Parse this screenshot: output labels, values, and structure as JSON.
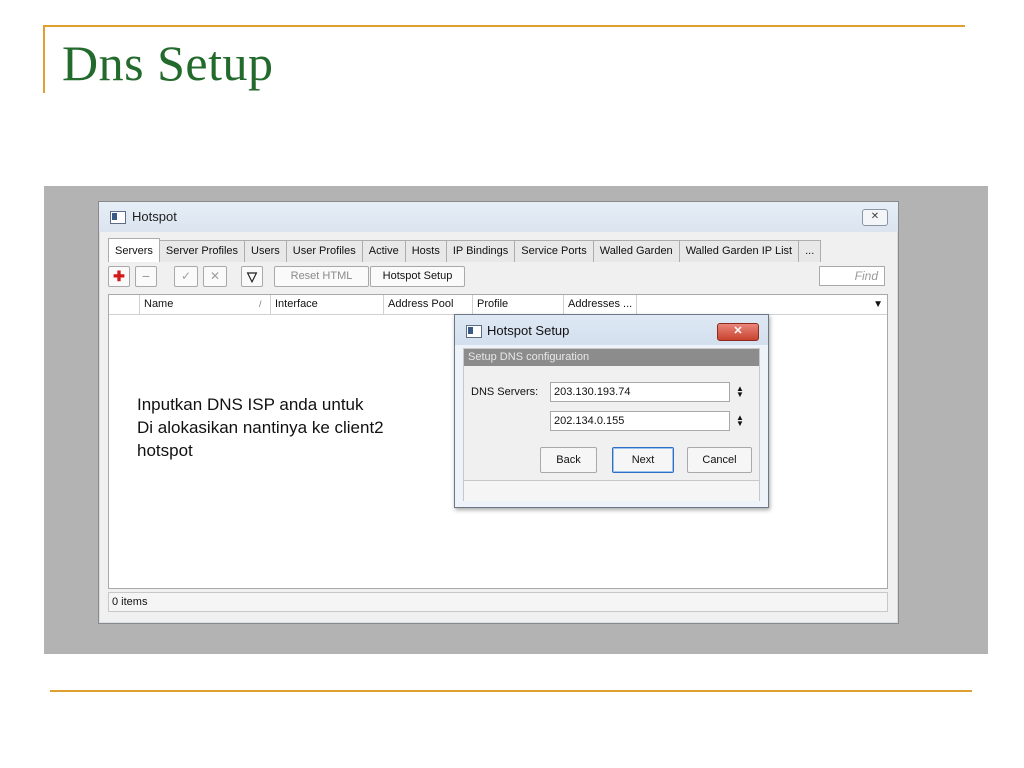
{
  "slide": {
    "title": "Dns Setup",
    "accent_color": "#e0a030",
    "title_color": "#236b2d"
  },
  "window": {
    "title": "Hotspot",
    "close_glyph": "✕",
    "icon": "window-icon",
    "tabs": [
      {
        "label": "Servers"
      },
      {
        "label": "Server Profiles"
      },
      {
        "label": "Users"
      },
      {
        "label": "User Profiles"
      },
      {
        "label": "Active"
      },
      {
        "label": "Hosts"
      },
      {
        "label": "IP Bindings"
      },
      {
        "label": "Service Ports"
      },
      {
        "label": "Walled Garden"
      },
      {
        "label": "Walled Garden IP List"
      },
      {
        "label": "..."
      }
    ],
    "active_tab": "Servers",
    "toolbar": {
      "add_glyph": "✚",
      "remove_glyph": "−",
      "enable_glyph": "✓",
      "disable_glyph": "✕",
      "filter_glyph": "▽",
      "reset_html_label": "Reset HTML",
      "hotspot_setup_label": "Hotspot Setup",
      "find_placeholder": "Find"
    },
    "columns": {
      "name": "Name",
      "sort_glyph": "/",
      "interface": "Interface",
      "address_pool": "Address Pool",
      "profile": "Profile",
      "addresses": "Addresses ...",
      "dropdown_glyph": "▼"
    },
    "status": "0 items"
  },
  "note": {
    "line1": "Inputkan DNS ISP anda untuk",
    "line2": "Di alokasikan nantinya ke client2",
    "line3": "hotspot"
  },
  "dialog": {
    "title": "Hotspot Setup",
    "close_glyph": "✕",
    "subtitle": "Setup DNS configuration",
    "dns_label": "DNS Servers:",
    "dns1": "203.130.193.74",
    "dns2": "202.134.0.155",
    "spin_glyph": "▲▼",
    "back_label": "Back",
    "next_label": "Next",
    "cancel_label": "Cancel"
  }
}
